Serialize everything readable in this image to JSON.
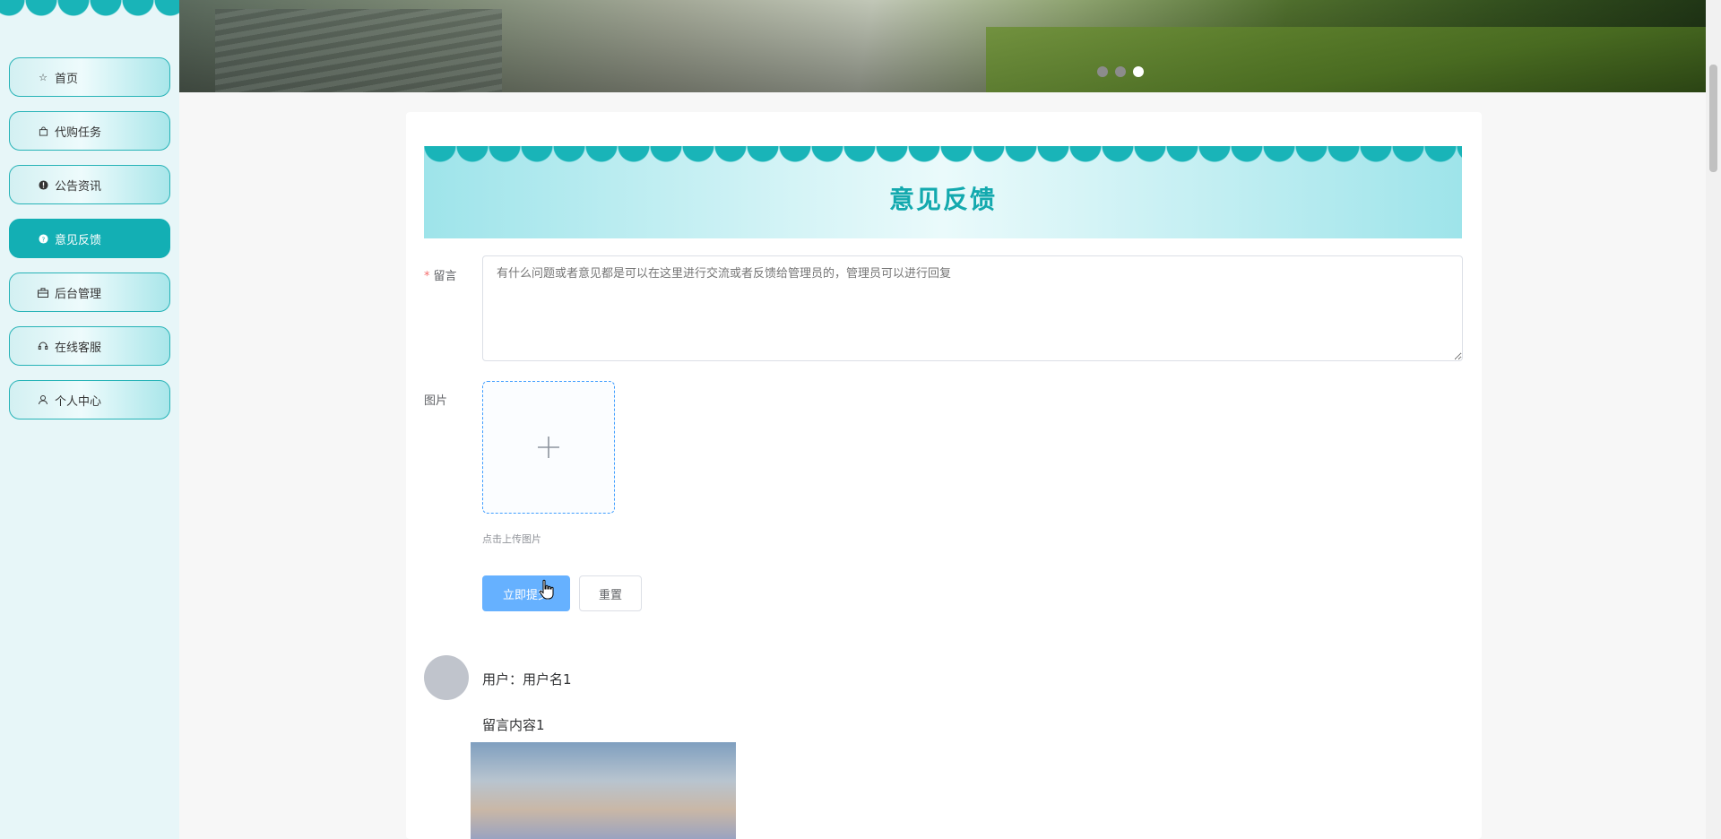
{
  "sidebar": {
    "items": [
      {
        "label": "首页",
        "icon": "star-icon",
        "active": false
      },
      {
        "label": "代购任务",
        "icon": "shopping-bag-icon",
        "active": false
      },
      {
        "label": "公告资讯",
        "icon": "info-circle-icon",
        "active": false
      },
      {
        "label": "意见反馈",
        "icon": "question-circle-icon",
        "active": true
      },
      {
        "label": "后台管理",
        "icon": "briefcase-icon",
        "active": false
      },
      {
        "label": "在线客服",
        "icon": "headset-icon",
        "active": false
      },
      {
        "label": "个人中心",
        "icon": "user-icon",
        "active": false
      }
    ]
  },
  "banner": {
    "slide_count": 3,
    "active_slide": 3
  },
  "feedback": {
    "title": "意见反馈",
    "message_label": "留言",
    "message_value": "有什么问题或者意见都是可以在这里进行交流或者反馈给管理员的，管理员可以进行回复",
    "image_label": "图片",
    "upload_tip": "点击上传图片",
    "submit_label": "立即提交",
    "reset_label": "重置"
  },
  "comments": [
    {
      "user_line": "用户：用户名1",
      "content": "留言内容1"
    }
  ],
  "colors": {
    "accent": "#13afb4",
    "primary_button": "#66b1ff",
    "required": "#f56c6c"
  }
}
